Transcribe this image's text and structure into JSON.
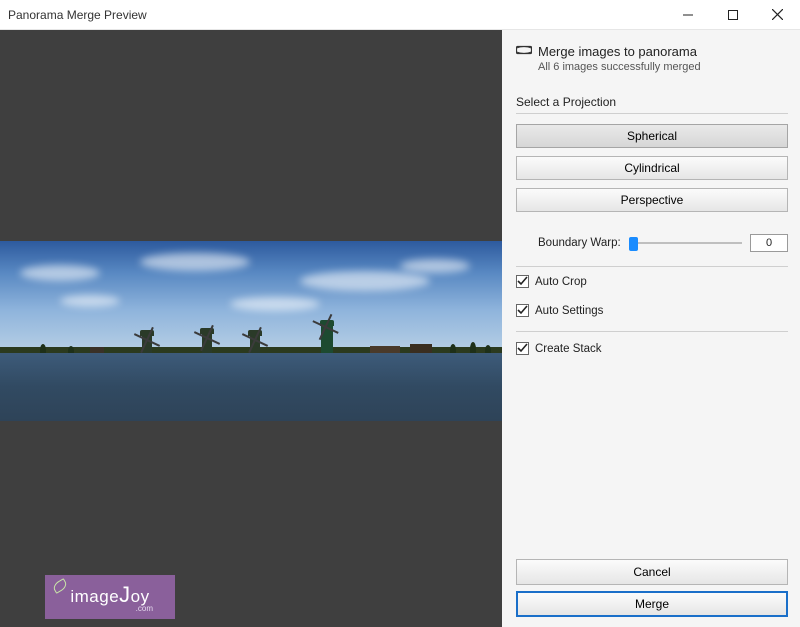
{
  "window": {
    "title": "Panorama Merge Preview"
  },
  "header": {
    "title": "Merge images to panorama",
    "subtitle": "All 6 images successfully merged",
    "icon": "panorama-icon"
  },
  "projection": {
    "label": "Select a Projection",
    "options": [
      "Spherical",
      "Cylindrical",
      "Perspective"
    ],
    "selected": "Spherical"
  },
  "boundary_warp": {
    "label": "Boundary Warp:",
    "value": "0"
  },
  "checks": {
    "auto_crop": {
      "label": "Auto Crop",
      "checked": true
    },
    "auto_settings": {
      "label": "Auto Settings",
      "checked": true
    },
    "create_stack": {
      "label": "Create Stack",
      "checked": true
    }
  },
  "actions": {
    "cancel": "Cancel",
    "merge": "Merge"
  },
  "watermark": {
    "main": "imageJoy",
    "sub": ".com"
  }
}
